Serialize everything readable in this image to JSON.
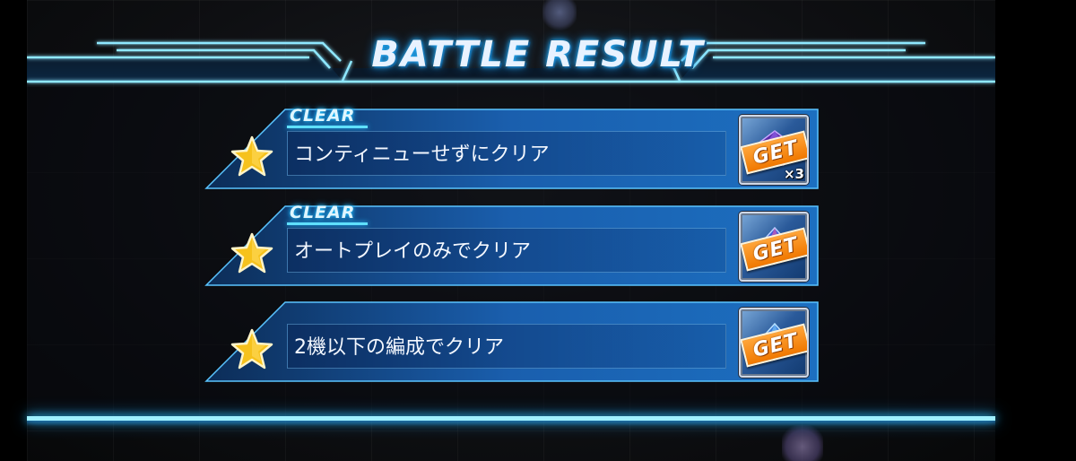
{
  "header": {
    "title": "BATTLE RESULT"
  },
  "missions": [
    {
      "clear_label": "CLEAR",
      "condition": "コンティニューせずにクリア",
      "cleared": true,
      "reward_label": "GET",
      "reward_qty": "×3",
      "reward_icon": "gem-icon"
    },
    {
      "clear_label": "CLEAR",
      "condition": "オートプレイのみでクリア",
      "cleared": true,
      "reward_label": "GET",
      "reward_qty": "",
      "reward_icon": "crystal-icon"
    },
    {
      "clear_label": "",
      "condition": "2機以下の編成でクリア",
      "cleared": false,
      "reward_label": "GET",
      "reward_qty": "",
      "reward_icon": "crystal-icon"
    }
  ],
  "colors": {
    "accent_glow": "#30c8ff",
    "panel_blue": "#1a5fae",
    "get_orange": "#f07800",
    "star_gold": "#f6c21c"
  }
}
